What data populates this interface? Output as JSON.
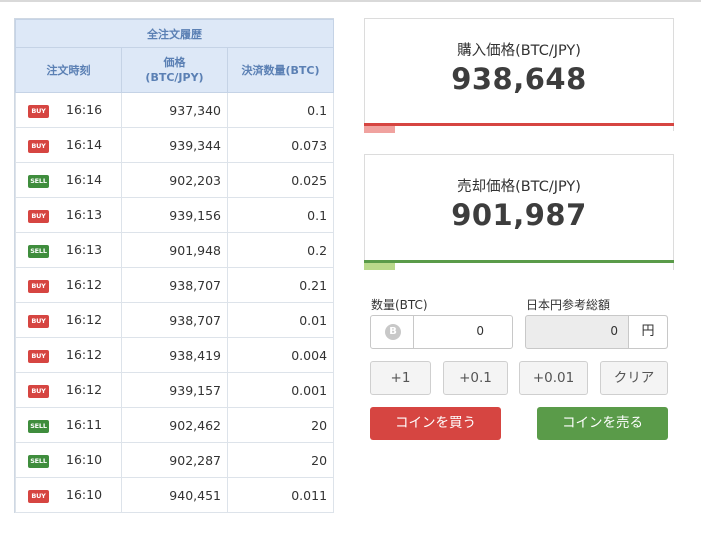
{
  "history": {
    "title": "全注文履歴",
    "headers": {
      "time": "注文時刻",
      "price_line1": "価格",
      "price_line2": "(BTC/JPY)",
      "qty": "決済数量(BTC)"
    },
    "rows": [
      {
        "side": "BUY",
        "time": "16:16",
        "price": "937,340",
        "qty": "0.1"
      },
      {
        "side": "BUY",
        "time": "16:14",
        "price": "939,344",
        "qty": "0.073"
      },
      {
        "side": "SELL",
        "time": "16:14",
        "price": "902,203",
        "qty": "0.025"
      },
      {
        "side": "BUY",
        "time": "16:13",
        "price": "939,156",
        "qty": "0.1"
      },
      {
        "side": "SELL",
        "time": "16:13",
        "price": "901,948",
        "qty": "0.2"
      },
      {
        "side": "BUY",
        "time": "16:12",
        "price": "938,707",
        "qty": "0.21"
      },
      {
        "side": "BUY",
        "time": "16:12",
        "price": "938,707",
        "qty": "0.01"
      },
      {
        "side": "BUY",
        "time": "16:12",
        "price": "938,419",
        "qty": "0.004"
      },
      {
        "side": "BUY",
        "time": "16:12",
        "price": "939,157",
        "qty": "0.001"
      },
      {
        "side": "SELL",
        "time": "16:11",
        "price": "902,462",
        "qty": "20"
      },
      {
        "side": "SELL",
        "time": "16:10",
        "price": "902,287",
        "qty": "20"
      },
      {
        "side": "BUY",
        "time": "16:10",
        "price": "940,451",
        "qty": "0.011"
      }
    ]
  },
  "buy_price": {
    "label": "購入価格(BTC/JPY)",
    "value": "938,648"
  },
  "sell_price": {
    "label": "売却価格(BTC/JPY)",
    "value": "901,987"
  },
  "form": {
    "qty_label": "数量(BTC)",
    "qty_value": "0",
    "btc_icon_glyph": "B",
    "jpy_label": "日本円参考総額",
    "jpy_value": "0",
    "jpy_unit": "円",
    "steps": [
      "+1",
      "+0.1",
      "+0.01"
    ],
    "clear": "クリア",
    "buy_button": "コインを買う",
    "sell_button": "コインを売る"
  },
  "colors": {
    "buy": "#d64541",
    "sell": "#5a9b49",
    "header_bg": "#dde8f7",
    "header_text": "#5b80b4"
  },
  "icons": {
    "btc": "bitcoin-coin-icon"
  }
}
